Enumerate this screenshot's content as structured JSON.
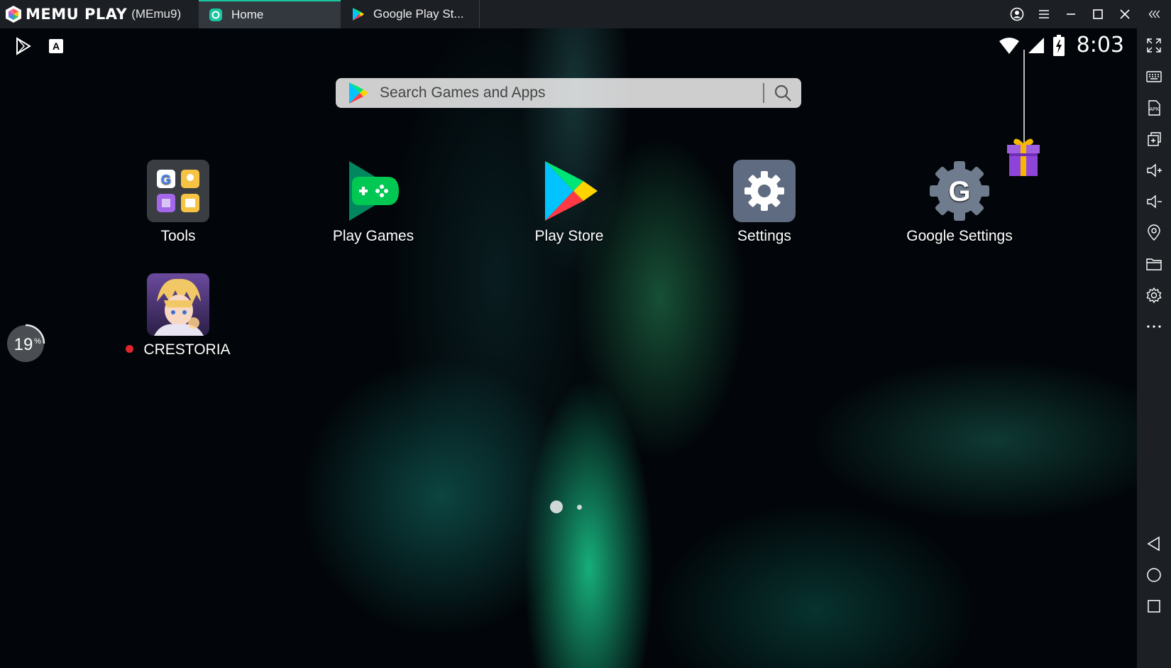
{
  "titlebar": {
    "brand": "MEMU PLAY",
    "instance": "(MEmu9)",
    "tabs": [
      {
        "label": "Home",
        "active": true
      },
      {
        "label": "Google Play St..."
      }
    ]
  },
  "status": {
    "time": "8:03"
  },
  "search": {
    "placeholder": "Search Games and Apps"
  },
  "apps": [
    {
      "label": "Tools"
    },
    {
      "label": "Play Games"
    },
    {
      "label": "Play Store"
    },
    {
      "label": "Settings"
    },
    {
      "label": "Google Settings"
    },
    {
      "label": "CRESTORIA",
      "new": true
    }
  ],
  "progress": {
    "value": 19,
    "text": "19",
    "unit": "%"
  },
  "pages": {
    "count": 2,
    "current": 1
  },
  "colors": {
    "titlebar": "#1c1f24",
    "active_tab": "#33383f",
    "accent": "#18c7a0",
    "new_badge": "#e0262c"
  },
  "sidebar_icons": [
    "fullscreen-icon",
    "keyboard-icon",
    "apk-icon",
    "multi-window-icon",
    "volume-up-icon",
    "volume-down-icon",
    "location-icon",
    "folder-icon",
    "settings-icon",
    "more-icon",
    "back-icon",
    "home-icon",
    "recents-icon"
  ]
}
